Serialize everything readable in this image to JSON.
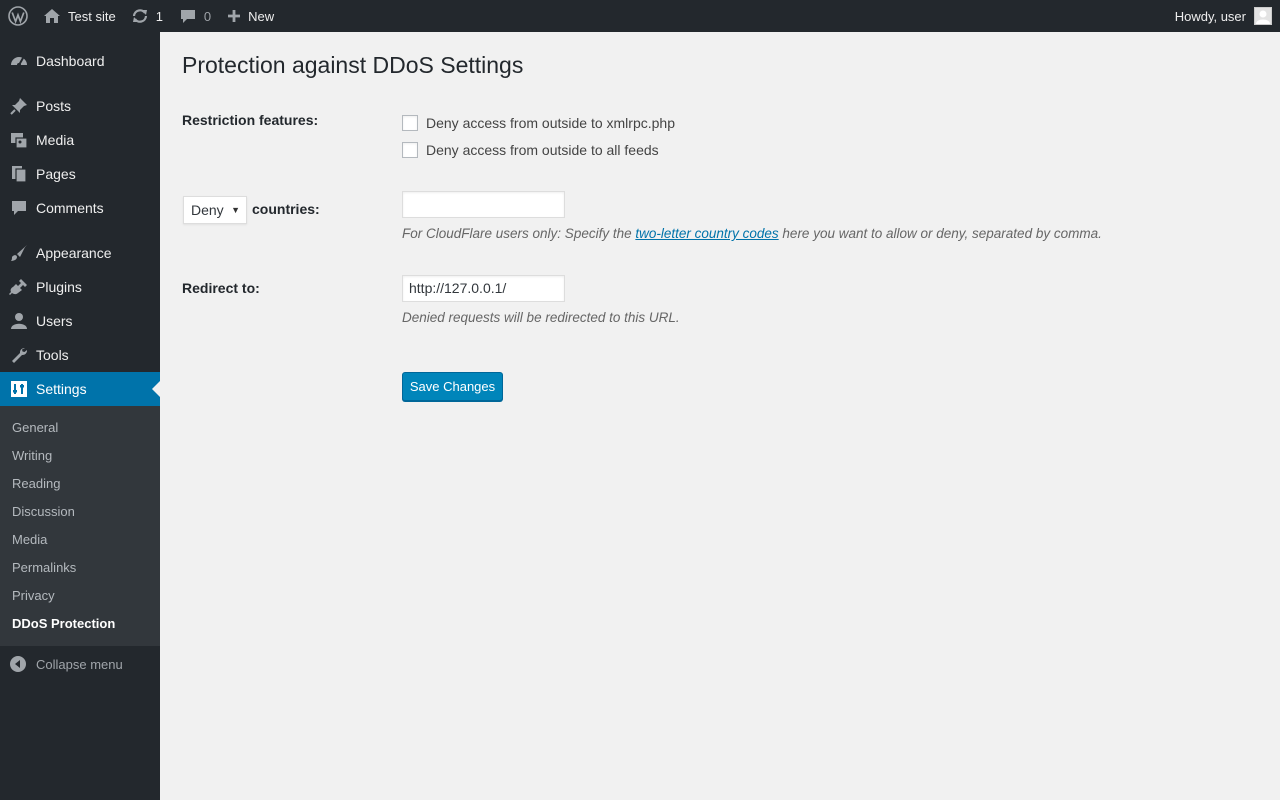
{
  "adminbar": {
    "wp_logo": "wordpress-logo-icon",
    "site_name": "Test site",
    "updates_count": "1",
    "comments_count": "0",
    "new_label": "New",
    "howdy": "Howdy, user"
  },
  "sidebar": {
    "items": [
      {
        "label": "Dashboard",
        "icon": "dashboard-icon"
      },
      {
        "label": "Posts",
        "icon": "pin-icon"
      },
      {
        "label": "Media",
        "icon": "media-icon"
      },
      {
        "label": "Pages",
        "icon": "pages-icon"
      },
      {
        "label": "Comments",
        "icon": "comment-icon"
      },
      {
        "label": "Appearance",
        "icon": "brush-icon"
      },
      {
        "label": "Plugins",
        "icon": "plugin-icon"
      },
      {
        "label": "Users",
        "icon": "user-icon"
      },
      {
        "label": "Tools",
        "icon": "wrench-icon"
      },
      {
        "label": "Settings",
        "icon": "settings-icon"
      }
    ],
    "submenu": [
      "General",
      "Writing",
      "Reading",
      "Discussion",
      "Media",
      "Permalinks",
      "Privacy",
      "DDoS Protection"
    ],
    "collapse": "Collapse menu"
  },
  "page": {
    "title": "Protection against DDoS Settings",
    "restriction_label": "Restriction features:",
    "checkbox_xmlrpc": "Deny access from outside to xmlrpc.php",
    "checkbox_feeds": "Deny access from outside to all feeds",
    "mode_select_value": "Deny",
    "countries_label": "countries:",
    "countries_value": "",
    "countries_desc_before": "For CloudFlare users only: Specify the ",
    "countries_desc_link": "two-letter country codes",
    "countries_desc_after": " here you want to allow or deny, separated by comma.",
    "redirect_label": "Redirect to:",
    "redirect_value": "http://127.0.0.1/",
    "redirect_desc": "Denied requests will be redirected to this URL.",
    "save_button": "Save Changes"
  },
  "colors": {
    "adminbar_bg": "#23282d",
    "accent": "#0073aa",
    "button": "#0085ba",
    "content_bg": "#f1f1f1"
  }
}
